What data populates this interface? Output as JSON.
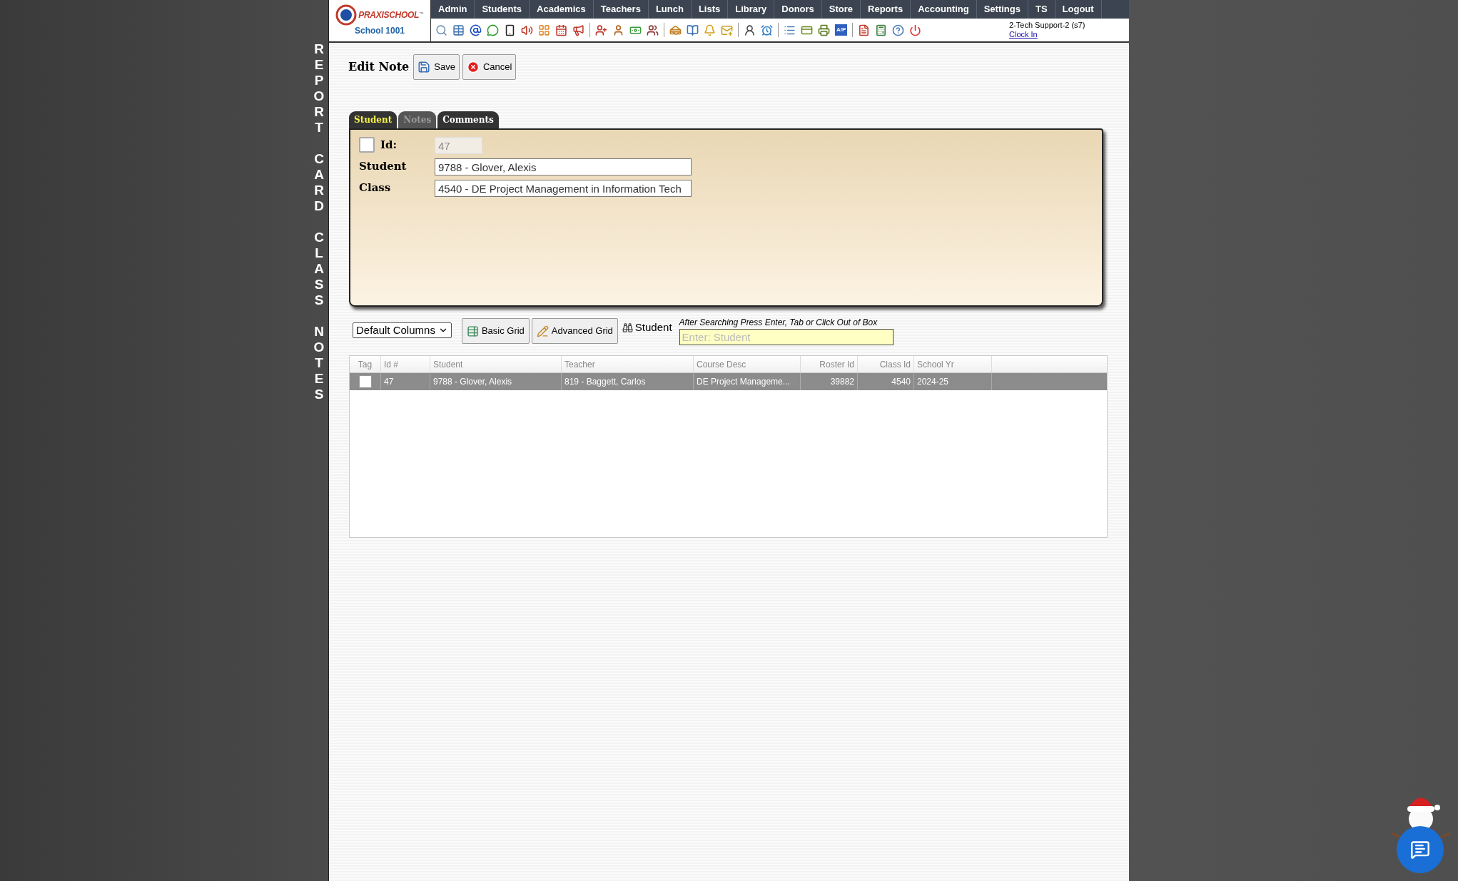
{
  "side_title": "REPORT CARD CLASS NOTES",
  "logo": {
    "brand": "PRAXISCHOOL",
    "tm": "™",
    "school": "School 1001"
  },
  "menu": [
    "Admin",
    "Students",
    "Academics",
    "Teachers",
    "Lunch",
    "Lists",
    "Library",
    "Donors",
    "Store",
    "Reports",
    "Accounting",
    "Settings",
    "TS",
    "Logout"
  ],
  "toolbar_badge": "A/P",
  "user": {
    "name": "2-Tech Support-2 (s7)",
    "clock_link": "Clock In"
  },
  "editor": {
    "title": "Edit Note",
    "buttons": [
      {
        "kind": "save",
        "label": "Save"
      },
      {
        "kind": "cancel",
        "label": "Cancel"
      }
    ]
  },
  "tabs": [
    {
      "label": "Student",
      "selected": true,
      "disabled": false
    },
    {
      "label": "Notes",
      "selected": false,
      "disabled": true
    },
    {
      "label": "Comments",
      "selected": false,
      "disabled": false
    }
  ],
  "form": {
    "tag_checked": false,
    "fields": [
      {
        "label": "Id:",
        "value": "47",
        "disabled": true
      },
      {
        "label": "Student",
        "value": "9788 - Glover, Alexis",
        "disabled": false
      },
      {
        "label": "Class",
        "value": "4540 - DE Project Management in Information Tech",
        "disabled": false
      }
    ]
  },
  "grid_tools": {
    "column_set": "Default Columns",
    "buttons": [
      {
        "kind": "basic",
        "label": "Basic Grid"
      },
      {
        "kind": "advanced",
        "label": "Advanced Grid"
      }
    ],
    "search_label": "Student",
    "hint": "After Searching Press Enter, Tab or Click Out of Box",
    "placeholder": "Enter: Student"
  },
  "grid": {
    "columns": [
      "Tag",
      "Id #",
      "Student",
      "Teacher",
      "Course Desc",
      "Roster Id",
      "Class Id",
      "School Yr"
    ],
    "rows": [
      {
        "selected": true,
        "checked": false,
        "cells": [
          "",
          "47",
          "9788 - Glover, Alexis",
          "819 - Baggett, Carlos",
          "DE Project Manageme...",
          "39882",
          "4540",
          "2024-25"
        ]
      }
    ]
  }
}
